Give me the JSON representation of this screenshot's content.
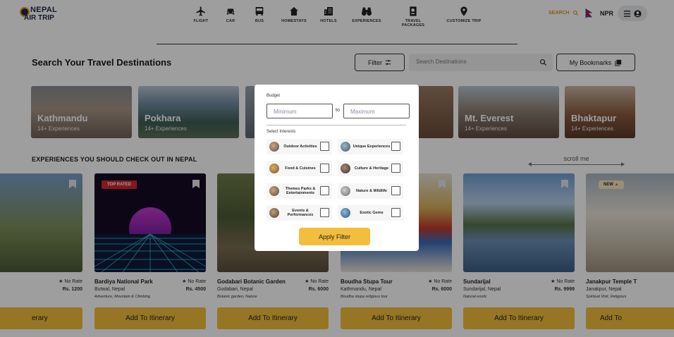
{
  "header": {
    "logo": {
      "line1": "NEPAL",
      "line2": "AIR TRIP"
    },
    "nav": [
      {
        "label": "FLIGHT",
        "icon": "plane-icon"
      },
      {
        "label": "CAR",
        "icon": "car-icon"
      },
      {
        "label": "BUS",
        "icon": "bus-icon"
      },
      {
        "label": "HOMESTAYS",
        "icon": "home-icon"
      },
      {
        "label": "HOTELS",
        "icon": "hotel-icon"
      },
      {
        "label": "EXPERIENCES",
        "icon": "binoculars-icon"
      },
      {
        "label": "TRAVEL PACKAGES",
        "icon": "passport-icon"
      },
      {
        "label": "CUSTOMIZE TRIP",
        "icon": "map-pin-plus-icon"
      }
    ],
    "search_label": "SEARCH",
    "currency": "NPR"
  },
  "search_section": {
    "title": "Search Your Travel Destinations",
    "filter_label": "Filter",
    "search_placeholder": "Search Destinations",
    "bookmarks_label": "My Bookmarks"
  },
  "destinations": [
    {
      "name": "Kathmandu",
      "experiences": "14+ Experiences"
    },
    {
      "name": "Pokhara",
      "experiences": "14+ Experiences"
    },
    {
      "name": "Mt. Everest",
      "experiences": "14+ Experiences"
    },
    {
      "name": "Bhaktapur",
      "experiences": "14+ Experiences"
    }
  ],
  "experiences_section": {
    "title": "EXPERIENCES YOU SHOULD CHECK OUT IN NEPAL",
    "scroll_hint": "scroll me"
  },
  "experiences": [
    {
      "name": "",
      "location": "",
      "tags": "",
      "rating": "No Rate",
      "price": "Rs. 1200",
      "button": "erary"
    },
    {
      "name": "Bardiya National Park",
      "location": "Butwal, Nepal",
      "tags": "Adventure, Mountain & Climbing",
      "rating": "No Rate",
      "price": "Rs. 4500",
      "badge": "TOP RATED",
      "button": "Add To Itinerary"
    },
    {
      "name": "Godabari Botanic Garden",
      "location": "Godabari, Nepal",
      "tags": "Botanic garden, Nature",
      "rating": "No Rate",
      "price": "Rs. 6000",
      "button": "Add To Itinerary"
    },
    {
      "name": "Boudha Stupa Tour",
      "location": "Kathmandu, Nepal",
      "tags": "Boudha stupa religious tour",
      "rating": "No Rate",
      "price": "Rs. 6000",
      "button": "Add To Itinerary"
    },
    {
      "name": "Sundarijal",
      "location": "Sundarijal, Nepal",
      "tags": "Natural exotic",
      "rating": "No Rate",
      "price": "Rs. 9999",
      "button": "Add To Itinerary"
    },
    {
      "name": "Janakpur Temple T",
      "location": "Janakpur, Nepal",
      "tags": "Spiritual Visit, Religious",
      "rating": "",
      "price": "",
      "badge": "NEW",
      "button": "Add To"
    }
  ],
  "filter_modal": {
    "budget_label": "Budget",
    "min_placeholder": "Minimum",
    "max_placeholder": "Maximum",
    "to_label": "to",
    "interests_label": "Select Interests",
    "interests": [
      {
        "label": "Outdoor Activities",
        "checked": false
      },
      {
        "label": "Unique Experiences",
        "checked": false
      },
      {
        "label": "Food & Cuisines",
        "checked": false
      },
      {
        "label": "Culture & Heritage",
        "checked": false
      },
      {
        "label": "Themes Parks & Entertainments",
        "checked": false
      },
      {
        "label": "Nature & Wildlife",
        "checked": false
      },
      {
        "label": "Events & Performances",
        "checked": false
      },
      {
        "label": "Exotic Gems",
        "checked": false
      }
    ],
    "apply_label": "Apply Filter"
  },
  "colors": {
    "accent": "#f2be3c",
    "brand": "#d69b2a",
    "badge_red": "#d3262e"
  }
}
